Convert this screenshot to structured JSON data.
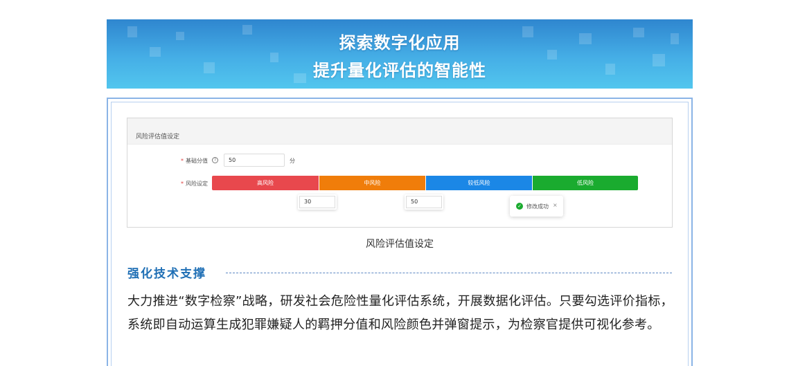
{
  "banner": {
    "line1": "探索数字化应用",
    "line2": "提升量化评估的智能性"
  },
  "screenshot": {
    "header_title": "风险评估值设定",
    "base_score_label": "基础分值",
    "base_score_value": "50",
    "base_score_unit": "分",
    "risk_label": "风险设定",
    "required_mark": "*",
    "segments": [
      "高风险",
      "中风险",
      "较低风险",
      "低风险"
    ],
    "thresholds": [
      "30",
      "50"
    ],
    "toast_message": "修改成功",
    "toast_close": "×",
    "colors": {
      "high": "#e8484d",
      "mid": "#f07d0a",
      "lowish": "#1b87e6",
      "low": "#1aab2f"
    }
  },
  "caption": "风险评估值设定",
  "section": {
    "title": "强化技术支撑",
    "paragraph": "大力推进“数字检察”战略，研发社会危险性量化评估系统，开展数据化评估。只要勾选评价指标，系统即自动运算生成犯罪嫌疑人的羁押分值和风险颜色并弹窗提示，为检察官提供可视化参考。"
  }
}
